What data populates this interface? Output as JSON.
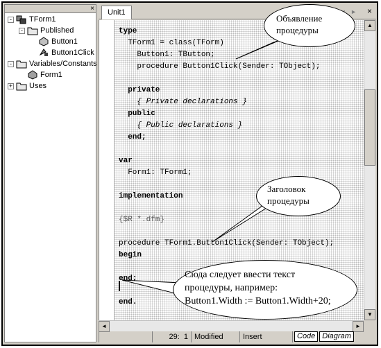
{
  "explorer": {
    "close_glyph": "×",
    "tree": [
      {
        "label": "TForm1",
        "expander": "-",
        "indent": 0,
        "icon": "class-icon"
      },
      {
        "label": "Published",
        "expander": "-",
        "indent": 1,
        "icon": "folder-icon"
      },
      {
        "label": "Button1",
        "expander": "",
        "indent": 2,
        "icon": "field-icon"
      },
      {
        "label": "Button1Click",
        "expander": "",
        "indent": 2,
        "icon": "method-icon"
      },
      {
        "label": "Variables/Constants",
        "expander": "-",
        "indent": 0,
        "icon": "folder-icon"
      },
      {
        "label": "Form1",
        "expander": "",
        "indent": 1,
        "icon": "variable-icon"
      },
      {
        "label": "Uses",
        "expander": "+",
        "indent": 0,
        "icon": "folder-icon"
      }
    ]
  },
  "editor": {
    "tab": "Unit1",
    "tab_arrows": "◄ ►",
    "tab_close": "×",
    "code_lines": [
      {
        "text": "type",
        "style": "kw"
      },
      {
        "text": "  TForm1 = class(TForm)",
        "style": ""
      },
      {
        "text": "    Button1: TButton;",
        "style": ""
      },
      {
        "text": "    procedure Button1Click(Sender: TObject);",
        "style": ""
      },
      {
        "text": "",
        "style": ""
      },
      {
        "text": "  private",
        "style": "kw"
      },
      {
        "text": "    { Private declarations }",
        "style": "cm"
      },
      {
        "text": "  public",
        "style": "kw"
      },
      {
        "text": "    { Public declarations }",
        "style": "cm"
      },
      {
        "text": "  end;",
        "style": "kw"
      },
      {
        "text": "",
        "style": ""
      },
      {
        "text": "var",
        "style": "kw"
      },
      {
        "text": "  Form1: TForm1;",
        "style": ""
      },
      {
        "text": "",
        "style": ""
      },
      {
        "text": "implementation",
        "style": "kw"
      },
      {
        "text": "",
        "style": ""
      },
      {
        "text": "{$R *.dfm}",
        "style": "dir"
      },
      {
        "text": "",
        "style": ""
      },
      {
        "text": "procedure TForm1.Button1Click(Sender: TObject);",
        "style": ""
      },
      {
        "text": "begin",
        "style": "kw"
      },
      {
        "text": "",
        "style": ""
      },
      {
        "text": "end;",
        "style": "kw"
      },
      {
        "text": "",
        "style": ""
      },
      {
        "text": "end.",
        "style": "kw"
      }
    ]
  },
  "status": {
    "line": "29:",
    "col": "1",
    "modified": "Modified",
    "mode": "Insert",
    "tab_code": "Code",
    "tab_diagram": "Diagram"
  },
  "callouts": {
    "declaration": [
      "Объявление",
      "процедуры"
    ],
    "header": [
      "Заголовок",
      "процедуры"
    ],
    "body": [
      "Сюда следует ввести текст",
      "процедуры, например:",
      "Button1.Width := Button1.Width+20;"
    ]
  }
}
